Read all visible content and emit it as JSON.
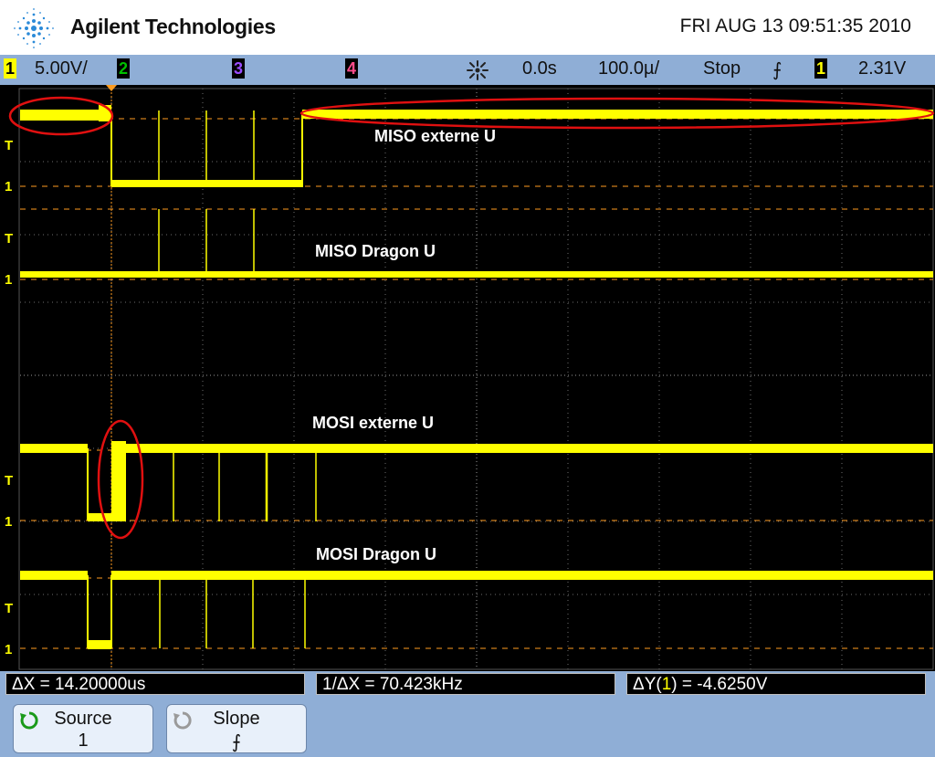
{
  "header": {
    "brand": "Agilent Technologies",
    "datetime": "FRI AUG 13 09:51:35 2010"
  },
  "status": {
    "ch1_num": "1",
    "ch1_scale": "5.00V/",
    "ch2_num": "2",
    "ch3_num": "3",
    "ch4_num": "4",
    "delay": "0.0s",
    "timebase": "100.0µ/",
    "run_state": "Stop",
    "trigger_slope": "⨍",
    "trigger_src": "1",
    "trigger_level": "2.31V"
  },
  "colors": {
    "ch1": "#ffff00",
    "ch2": "#00c000",
    "ch3": "#9a4cff",
    "ch4": "#ff4c8c",
    "annotation": "#e01010",
    "marker": "#ff9c20",
    "grid": "#7a7a7a",
    "chrome": "#8faed6"
  },
  "traces": {
    "miso_externe": "MISO externe U",
    "miso_dragon": "MISO Dragon U",
    "mosi_externe": "MOSI externe U",
    "mosi_dragon": "MOSI Dragon U"
  },
  "markers": {
    "trig": "T",
    "gnd": "1"
  },
  "measurements": {
    "delta_x": "ΔX = 14.20000us",
    "inv_delta_x": "1/ΔX = 70.423kHz",
    "delta_y_prefix": "ΔY(",
    "delta_y_ch": "1",
    "delta_y_suffix": ") = -4.6250V"
  },
  "softkeys": {
    "source_label": "Source",
    "source_value": "1",
    "source_icon": "cycle-icon",
    "slope_label": "Slope",
    "slope_value": "⨍",
    "slope_icon": "cycle-icon"
  }
}
